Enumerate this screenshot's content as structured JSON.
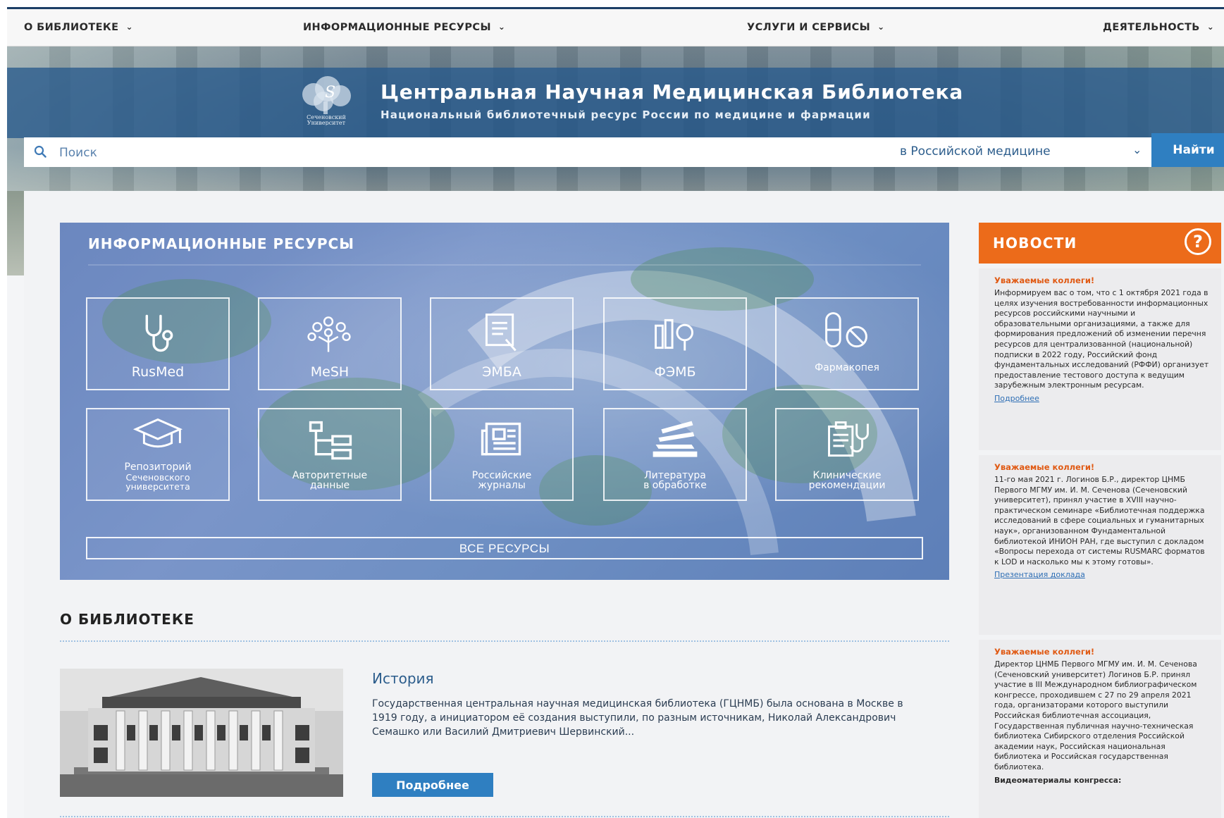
{
  "nav": {
    "items": [
      "О БИБЛИОТЕКЕ",
      "ИНФОРМАЦИОННЫЕ РЕСУРСЫ",
      "УСЛУГИ И СЕРВИСЫ",
      "ДЕЯТЕЛЬНОСТЬ"
    ]
  },
  "hero": {
    "logo_caption_line1": "Сеченовский",
    "logo_caption_line2": "Университет",
    "title": "Центральная Научная Медицинская Библиотека",
    "subtitle": "Национальный библиотечный ресурс России по медицине и фармации"
  },
  "search": {
    "placeholder": "Поиск",
    "scope": "в Российской медицине",
    "button": "Найти"
  },
  "resources": {
    "title": "ИНФОРМАЦИОННЫЕ РЕСУРСЫ",
    "tiles": [
      {
        "label": "RusMed",
        "icon": "stethoscope-icon"
      },
      {
        "label": "MeSH",
        "icon": "tree-icon"
      },
      {
        "label": "ЭМБА",
        "icon": "document-hand-icon"
      },
      {
        "label": "ФЭМБ",
        "icon": "books-magnifier-icon"
      },
      {
        "label": "Фармакопея",
        "icon": "pills-icon"
      },
      {
        "label_lines": [
          "Репозиторий",
          "Сеченовского",
          "университета"
        ],
        "icon": "graduation-cap-icon"
      },
      {
        "label_lines": [
          "Авторитетные",
          "данные"
        ],
        "icon": "hierarchy-icon"
      },
      {
        "label_lines": [
          "Российские",
          "журналы"
        ],
        "icon": "newspaper-icon"
      },
      {
        "label_lines": [
          "Литература",
          "в обработке"
        ],
        "icon": "paper-stack-icon"
      },
      {
        "label_lines": [
          "Клинические",
          "рекомендации"
        ],
        "icon": "clipboard-stethoscope-icon"
      }
    ],
    "all_button": "ВСЕ РЕСУРСЫ"
  },
  "about": {
    "title": "О БИБЛИОТЕКЕ",
    "history_title": "История",
    "history_text": "Государственная центральная научная медицинская библиотека (ГЦНМБ) была основана в Москве в 1919 году, а инициатором её создания выступили, по разным источникам, Николай Александрович Семашко или Василий Дмитриевич Шервинский...",
    "more_button": "Подробнее"
  },
  "news": {
    "title": "НОВОСТИ",
    "help": "?",
    "items": [
      {
        "heading": "Уважаемые коллеги!",
        "body": "Информируем вас о том, что с 1 октября 2021 года в целях изучения востребованности информационных ресурсов российскими научными и образовательными организациями, а также для формирования предложений об изменении перечня ресурсов для централизованной (национальной) подписки в 2022 году, Российский фонд фундаментальных исследований (РФФИ) организует предоставление тестового доступа к ведущим зарубежным электронным ресурсам.",
        "link": "Подробнее"
      },
      {
        "heading": "Уважаемые коллеги!",
        "body": "11-го мая 2021 г. Логинов Б.Р., директор ЦНМБ Первого МГМУ им. И. М. Сеченова (Сеченовский университет), принял участие в XVIII научно-практическом семинаре «Библиотечная поддержка исследований в сфере социальных и гуманитарных наук», организованном Фундаментальной библиотекой ИНИОН РАН, где выступил с докладом «Вопросы перехода от системы RUSMARC форматов к LOD и насколько мы к этому готовы».",
        "link": "Презентация доклада"
      },
      {
        "heading": "Уважаемые коллеги!",
        "body": "Директор ЦНМБ Первого МГМУ им. И. М. Сеченова (Сеченовский университет) Логинов Б.Р. принял участие в III Международном библиографическом конгрессе, проходившем с 27 по 29 апреля 2021 года, организаторами которого выступили Российская библиотечная ассоциация, Государственная публичная научно-техническая библиотека Сибирского отделения Российской академии наук, Российская национальная библиотека и Российская государственная библиотека.",
        "tail": "Видеоматериалы конгресса:"
      }
    ]
  },
  "colors": {
    "accent": "#2f7fc1",
    "news": "#ec6b1a",
    "panel": "#6b87bf",
    "link": "#2c5d8c"
  }
}
